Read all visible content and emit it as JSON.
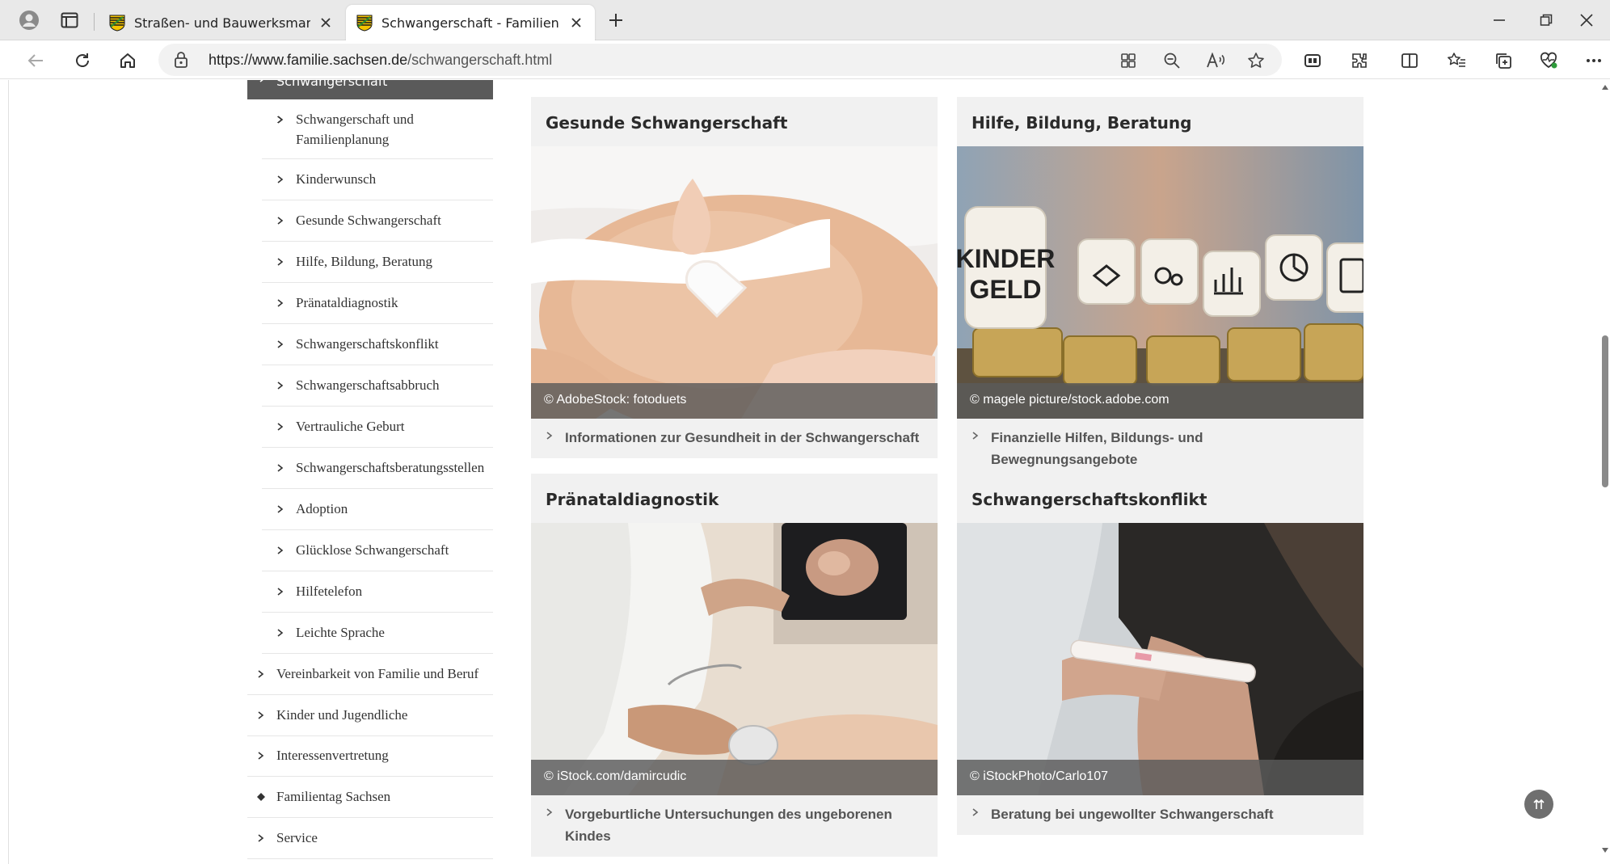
{
  "browser": {
    "tabs": [
      {
        "title": "Straßen- und Bauwerksmanagem",
        "active": false
      },
      {
        "title": "Schwangerschaft - Familien in Sa",
        "active": true
      }
    ],
    "url_host": "https://www.familie.sachsen.de",
    "url_path": "/schwangerschaft.html",
    "icons": [
      "profile-icon",
      "tab-actions-icon",
      "new-tab-icon",
      "back-icon",
      "refresh-icon",
      "home-icon",
      "site-info-icon",
      "app-available-icon",
      "zoom-out-icon",
      "read-aloud-icon",
      "favorite-star-icon",
      "browser-essentials-icon",
      "extensions-icon",
      "split-screen-icon",
      "favorites-icon",
      "collections-icon",
      "health-icon",
      "more-icon",
      "minimize-icon",
      "restore-icon",
      "close-window-icon"
    ]
  },
  "sidebar": {
    "active_label": "Schwangerschaft",
    "sub_items": [
      {
        "label": "Schwangerschaft und Familienplanung"
      },
      {
        "label": "Kinderwunsch"
      },
      {
        "label": "Gesunde Schwangerschaft"
      },
      {
        "label": "Hilfe, Bildung, Beratung"
      },
      {
        "label": "Pränataldiagnostik"
      },
      {
        "label": "Schwangerschaftskonflikt"
      },
      {
        "label": "Schwangerschaftsabbruch"
      },
      {
        "label": "Vertrauliche Geburt"
      },
      {
        "label": "Schwangerschaftsberatungsstellen"
      },
      {
        "label": "Adoption"
      },
      {
        "label": "Glücklose Schwangerschaft"
      },
      {
        "label": "Hilfetelefon"
      },
      {
        "label": "Leichte Sprache"
      }
    ],
    "top_items": [
      {
        "label": "Vereinbarkeit von Familie und Beruf"
      },
      {
        "label": "Kinder und Jugendliche"
      },
      {
        "label": "Interessenvertretung"
      },
      {
        "label": "Familientag Sachsen"
      },
      {
        "label": "Service"
      }
    ]
  },
  "cards": [
    {
      "title": "Gesunde Schwangerschaft",
      "credit": "© AdobeStock: fotoduets",
      "link": "Informationen zur Gesundheit in der Schwangerschaft"
    },
    {
      "title": "Hilfe, Bildung, Beratung",
      "credit": "© magele picture/stock.adobe.com",
      "link": "Finanzielle Hilfen, Bildungs- und Bewegnungsangebote",
      "image_text": [
        "KINDER",
        "GELD"
      ]
    },
    {
      "title": "Pränataldiagnostik",
      "credit": "© iStock.com/damircudic",
      "link": "Vorgeburtliche Untersuchungen des ungeborenen Kindes"
    },
    {
      "title": "Schwangerschaftskonflikt",
      "credit": "© iStockPhoto/Carlo107",
      "link": "Beratung bei ungewollter Schwangerschaft"
    }
  ],
  "colors": {
    "sidebar_active_bg": "#5a5a5a",
    "card_bg": "#f1f1f1",
    "credit_bar": "#5a5a5a"
  }
}
